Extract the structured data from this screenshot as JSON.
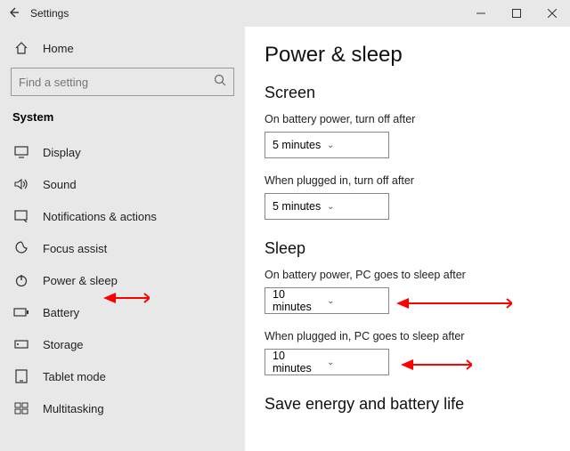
{
  "titlebar": {
    "title": "Settings"
  },
  "sidebar": {
    "home": "Home",
    "search_placeholder": "Find a setting",
    "category": "System",
    "items": [
      {
        "label": "Display"
      },
      {
        "label": "Sound"
      },
      {
        "label": "Notifications & actions"
      },
      {
        "label": "Focus assist"
      },
      {
        "label": "Power & sleep"
      },
      {
        "label": "Battery"
      },
      {
        "label": "Storage"
      },
      {
        "label": "Tablet mode"
      },
      {
        "label": "Multitasking"
      }
    ]
  },
  "content": {
    "heading": "Power & sleep",
    "screen": {
      "title": "Screen",
      "battery_label": "On battery power, turn off after",
      "battery_value": "5 minutes",
      "plugged_label": "When plugged in, turn off after",
      "plugged_value": "5 minutes"
    },
    "sleep": {
      "title": "Sleep",
      "battery_label": "On battery power, PC goes to sleep after",
      "battery_value": "10 minutes",
      "plugged_label": "When plugged in, PC goes to sleep after",
      "plugged_value": "10 minutes"
    },
    "save_heading": "Save energy and battery life"
  },
  "annotations": {
    "color": "#ff0000"
  }
}
